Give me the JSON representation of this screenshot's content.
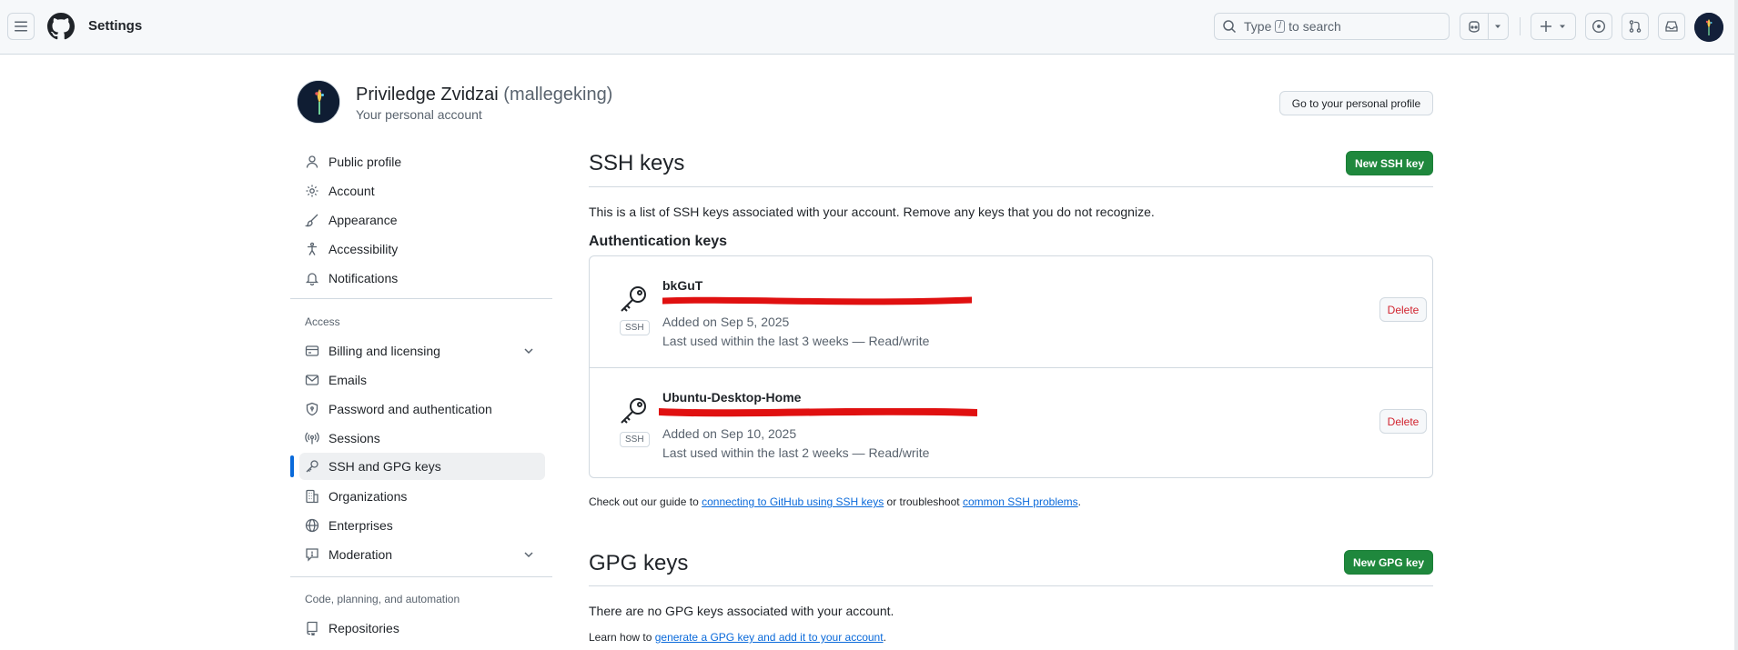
{
  "header": {
    "title": "Settings",
    "search_prefix": "Type",
    "search_key": "/",
    "search_suffix": "to search"
  },
  "profile": {
    "name": "Priviledge Zvidzai",
    "login": "(mallegeking)",
    "subtitle": "Your personal account",
    "go_to_profile": "Go to your personal profile"
  },
  "sidebar": {
    "items": [
      {
        "label": "Public profile",
        "icon": "person-icon"
      },
      {
        "label": "Account",
        "icon": "gear-icon"
      },
      {
        "label": "Appearance",
        "icon": "paintbrush-icon"
      },
      {
        "label": "Accessibility",
        "icon": "accessibility-icon"
      },
      {
        "label": "Notifications",
        "icon": "bell-icon"
      }
    ],
    "access_heading": "Access",
    "access_items": [
      {
        "label": "Billing and licensing",
        "icon": "credit-card-icon"
      },
      {
        "label": "Emails",
        "icon": "mail-icon"
      },
      {
        "label": "Password and authentication",
        "icon": "shield-lock-icon"
      },
      {
        "label": "Sessions",
        "icon": "broadcast-icon"
      },
      {
        "label": "SSH and GPG keys",
        "icon": "key-icon"
      },
      {
        "label": "Organizations",
        "icon": "organization-icon"
      },
      {
        "label": "Enterprises",
        "icon": "globe-icon"
      },
      {
        "label": "Moderation",
        "icon": "report-icon"
      }
    ],
    "code_heading": "Code, planning, and automation",
    "code_items": [
      {
        "label": "Repositories",
        "icon": "repo-icon"
      }
    ]
  },
  "ssh": {
    "title": "SSH keys",
    "new_button": "New SSH key",
    "description": "This is a list of SSH keys associated with your account. Remove any keys that you do not recognize.",
    "auth_heading": "Authentication keys",
    "keys": [
      {
        "title": "bkGuT",
        "badge": "SSH",
        "added": "Added on Sep 5, 2025",
        "last_used": "Last used within the last 3 weeks — Read/write",
        "delete": "Delete"
      },
      {
        "title": "Ubuntu-Desktop-Home",
        "badge": "SSH",
        "added": "Added on Sep 10, 2025",
        "last_used": "Last used within the last 2 weeks — Read/write",
        "delete": "Delete"
      }
    ],
    "guide_prefix": "Check out our guide to",
    "guide_link1": "connecting to GitHub using SSH keys",
    "guide_mid": "or troubleshoot",
    "guide_link2": "common SSH problems",
    "guide_suffix": "."
  },
  "gpg": {
    "title": "GPG keys",
    "new_button": "New GPG key",
    "empty": "There are no GPG keys associated with your account.",
    "learn_prefix": "Learn how to",
    "learn_link": "generate a GPG key and add it to your account",
    "learn_suffix": "."
  },
  "colors": {
    "accent": "#0969da",
    "green_button": "#1f883d",
    "danger": "#d1242f",
    "redaction": "#e01010"
  }
}
